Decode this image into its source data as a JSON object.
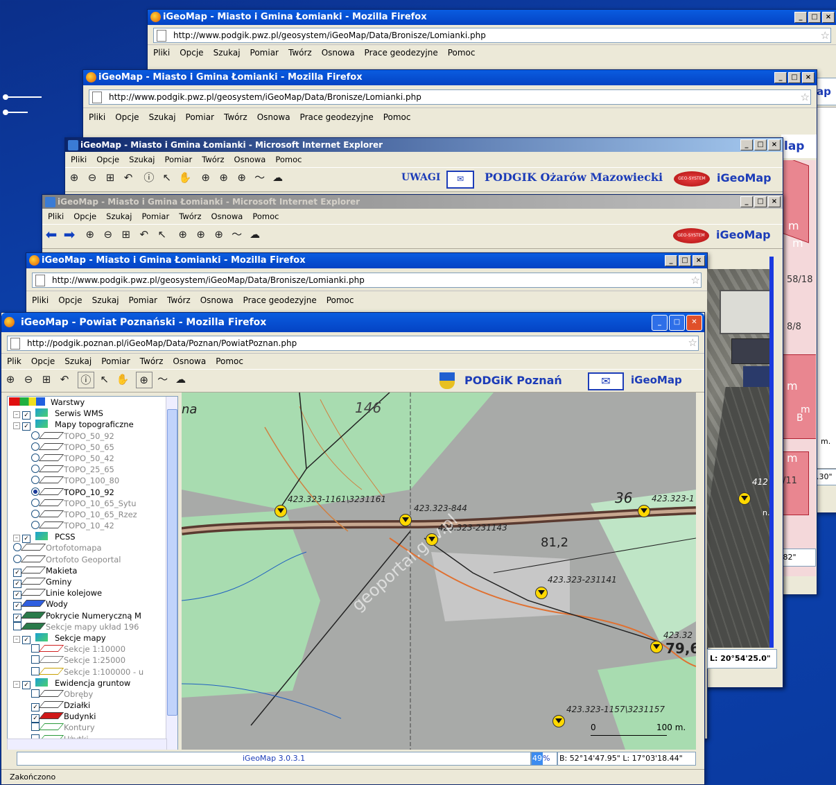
{
  "win1": {
    "title": "iGeoMap - Miasto i Gmina Łomianki - Mozilla Firefox",
    "url": "http://www.podgik.pwz.pl/geosystem/iGeoMap/Data/Bronisze/Lomianki.php",
    "menu": [
      "Pliki",
      "Opcje",
      "Szukaj",
      "Pomiar",
      "Twórz",
      "Osnowa",
      "Prace geodezyjne",
      "Pomoc"
    ],
    "edge_brand": "ap",
    "edge_text1": "m.",
    "edge_text2": ".30\""
  },
  "win2": {
    "title": "iGeoMap - Miasto i Gmina Łomianki - Mozilla Firefox",
    "url": "http://www.podgik.pwz.pl/geosystem/iGeoMap/Data/Bronisze/Lomianki.php",
    "menu": [
      "Pliki",
      "Opcje",
      "Szukaj",
      "Pomiar",
      "Twórz",
      "Osnowa",
      "Prace geodezyjne",
      "Pomoc"
    ],
    "edge_brand": "lap",
    "parcel_label1": "58/18",
    "parcel_label2": "8/8",
    "parcel_label3": "/11",
    "parcel_coord": ".82\"",
    "m_labels": [
      "m",
      "m",
      "m",
      "m",
      "m",
      "B"
    ]
  },
  "win3": {
    "title": "iGeoMap - Miasto i Gmina Łomianki - Microsoft Internet Explorer",
    "menu": [
      "Pliki",
      "Opcje",
      "Szukaj",
      "Pomiar",
      "Twórz",
      "Osnowa",
      "Pomoc"
    ],
    "uwagi": "UWAGI",
    "podgik": "PODGIK Ożarów Mazowiecki",
    "brand": "iGeoMap",
    "logo_text": "GEO-SYSTEM"
  },
  "win4": {
    "title": "iGeoMap - Miasto i Gmina Łomianki - Microsoft Internet Explorer",
    "menu": [
      "Pliki",
      "Opcje",
      "Szukaj",
      "Pomiar",
      "Twórz",
      "Osnowa",
      "Pomoc"
    ],
    "brand": "iGeoMap",
    "logo_text": "GEO-SYSTEM"
  },
  "win5": {
    "title": "iGeoMap - Miasto i Gmina Łomianki - Mozilla Firefox",
    "url": "http://www.podgik.pwz.pl/geosystem/iGeoMap/Data/Bronisze/Lomianki.php",
    "menu": [
      "Pliki",
      "Opcje",
      "Szukaj",
      "Pomiar",
      "Twórz",
      "Osnowa",
      "Prace geodezyjne",
      "Pomoc"
    ],
    "map_point": "412",
    "m_label": "n.",
    "coord": "L: 20°54'25.0\""
  },
  "front": {
    "title": "iGeoMap - Powiat Poznański - Mozilla Firefox",
    "url": "http://podgik.poznan.pl/iGeoMap/Data/Poznan/PowiatPoznan.php",
    "menu": [
      "Plik",
      "Opcje",
      "Szukaj",
      "Pomiar",
      "Twórz",
      "Osnowa",
      "Pomoc"
    ],
    "podgik": "PODGiK Poznań",
    "brand": "iGeoMap",
    "layers": [
      {
        "indent": 0,
        "type": "root",
        "label": "Warstwy"
      },
      {
        "indent": 1,
        "type": "group",
        "label": "Serwis WMS",
        "checked": true
      },
      {
        "indent": 1,
        "type": "group",
        "label": "Mapy topograficzne",
        "checked": true
      },
      {
        "indent": 2,
        "type": "radio",
        "label": "TOPO_50_92",
        "on": false,
        "gray": true,
        "color": "#fff"
      },
      {
        "indent": 2,
        "type": "radio",
        "label": "TOPO_50_65",
        "on": false,
        "gray": true,
        "color": "#fff"
      },
      {
        "indent": 2,
        "type": "radio",
        "label": "TOPO_50_42",
        "on": false,
        "gray": true,
        "color": "#fff"
      },
      {
        "indent": 2,
        "type": "radio",
        "label": "TOPO_25_65",
        "on": false,
        "gray": true,
        "color": "#fff"
      },
      {
        "indent": 2,
        "type": "radio",
        "label": "TOPO_100_80",
        "on": false,
        "gray": true,
        "color": "#fff"
      },
      {
        "indent": 2,
        "type": "radio",
        "label": "TOPO_10_92",
        "on": true,
        "gray": false,
        "color": "#fff"
      },
      {
        "indent": 2,
        "type": "radio",
        "label": "TOPO_10_65_Sytu",
        "on": false,
        "gray": true,
        "color": "#fff"
      },
      {
        "indent": 2,
        "type": "radio",
        "label": "TOPO_10_65_Rzez",
        "on": false,
        "gray": true,
        "color": "#fff"
      },
      {
        "indent": 2,
        "type": "radio",
        "label": "TOPO_10_42",
        "on": false,
        "gray": true,
        "color": "#fff"
      },
      {
        "indent": 1,
        "type": "group",
        "label": "PCSS",
        "checked": true
      },
      {
        "indent": 1,
        "type": "radio",
        "label": "Ortofotomapa",
        "on": false,
        "gray": true,
        "color": "#fff"
      },
      {
        "indent": 1,
        "type": "radio",
        "label": "Ortofoto Geoportal",
        "on": false,
        "gray": true,
        "color": "#fff"
      },
      {
        "indent": 1,
        "type": "check",
        "label": "Makieta",
        "checked": true,
        "gray": false,
        "color": "#fff"
      },
      {
        "indent": 1,
        "type": "check",
        "label": "Gminy",
        "checked": true,
        "gray": false,
        "color": "#fff"
      },
      {
        "indent": 1,
        "type": "check",
        "label": "Linie kolejowe",
        "checked": true,
        "gray": false,
        "color": "#fff"
      },
      {
        "indent": 1,
        "type": "check",
        "label": "Wody",
        "checked": true,
        "gray": false,
        "color": "#2f5fe0"
      },
      {
        "indent": 1,
        "type": "check",
        "label": "Pokrycie Numeryczną M",
        "checked": true,
        "gray": false,
        "color": "#2a7a4a"
      },
      {
        "indent": 1,
        "type": "check",
        "label": "Sekcje mapy układ 196",
        "checked": false,
        "gray": true,
        "color": "#2a7a4a"
      },
      {
        "indent": 1,
        "type": "group",
        "label": "Sekcje mapy",
        "checked": true
      },
      {
        "indent": 2,
        "type": "check",
        "label": "Sekcje 1:10000",
        "checked": false,
        "gray": true,
        "color": "#fff",
        "border": "#d02020"
      },
      {
        "indent": 2,
        "type": "check",
        "label": "Sekcje 1:25000",
        "checked": false,
        "gray": true,
        "color": "#fff",
        "border": "#777"
      },
      {
        "indent": 2,
        "type": "check",
        "label": "Sekcje 1:100000 - u",
        "checked": false,
        "gray": true,
        "color": "#fff",
        "border": "#c8a000"
      },
      {
        "indent": 1,
        "type": "group",
        "label": "Ewidencja gruntow",
        "checked": true
      },
      {
        "indent": 2,
        "type": "check",
        "label": "Obręby",
        "checked": false,
        "gray": true,
        "color": "#fff"
      },
      {
        "indent": 2,
        "type": "check",
        "label": "Działki",
        "checked": true,
        "gray": false,
        "color": "#fff"
      },
      {
        "indent": 2,
        "type": "check",
        "label": "Budynki",
        "checked": true,
        "gray": false,
        "color": "#d01818"
      },
      {
        "indent": 2,
        "type": "check",
        "label": "Kontury",
        "checked": false,
        "gray": true,
        "color": "#fff",
        "border": "#2a9a3a"
      },
      {
        "indent": 2,
        "type": "check",
        "label": "Użytki",
        "checked": false,
        "gray": true,
        "color": "#fff",
        "border": "#2a9a3a"
      }
    ],
    "map_labels": {
      "na": "na",
      "n146": "146",
      "n36": "36",
      "p1": "423.323-1161\\3231161",
      "p2": "423.323-844",
      "p3": "423.323-231143",
      "p4": "423.323-231141",
      "p5": "423.32",
      "p6": "423.323-1157\\3231157",
      "p7": "423.323-1",
      "h812": "81,2",
      "h796": "79,6",
      "watermark": "geoportal.gov.pl",
      "scale_0": "0",
      "scale_100": "100 m."
    },
    "version": "iGeoMap 3.0.3.1",
    "progress": "49",
    "progress_pct": "%",
    "coords": "B: 52°14'47.95\" L: 17°03'18.44\"",
    "statusbar": "Zakończono"
  }
}
